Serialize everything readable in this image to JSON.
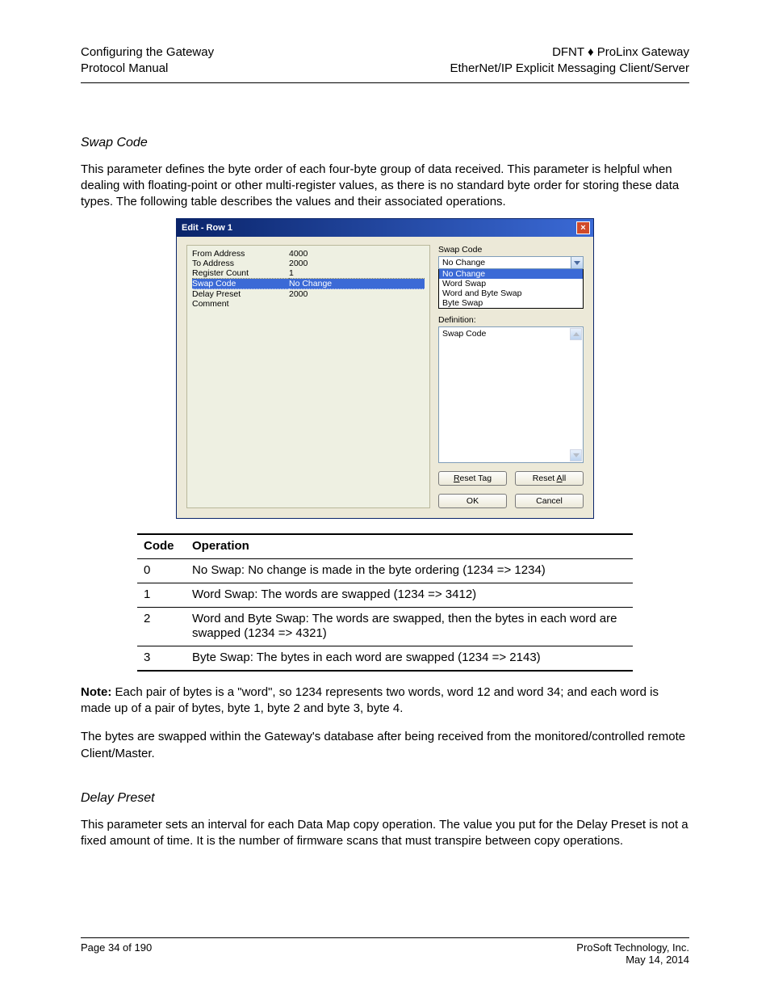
{
  "header": {
    "left_line1": "Configuring the Gateway",
    "left_line2": "Protocol Manual",
    "right_line1": "DFNT ♦ ProLinx Gateway",
    "right_line2": "EtherNet/IP Explicit Messaging Client/Server"
  },
  "section_title": "Swap Code",
  "intro_para": "This parameter defines the byte order of each four-byte group of data received. This parameter is helpful when dealing with floating-point or other multi-register values, as there is no standard byte order for storing these data types. The following table describes the values and their associated operations.",
  "dialog": {
    "title": "Edit - Row 1",
    "rows": [
      {
        "k": "From Address",
        "v": "4000"
      },
      {
        "k": "To Address",
        "v": "2000"
      },
      {
        "k": "Register Count",
        "v": "1",
        "dotted": true
      },
      {
        "k": "Swap Code",
        "v": "No Change",
        "selected": true,
        "dotted": true
      },
      {
        "k": "Delay Preset",
        "v": "2000"
      },
      {
        "k": "Comment",
        "v": ""
      }
    ],
    "right_label": "Swap Code",
    "combo_value": "No Change",
    "options": [
      "No Change",
      "Word Swap",
      "Word and Byte Swap",
      "Byte Swap"
    ],
    "selected_option_index": 0,
    "definition_label": "Definition:",
    "definition_text": "Swap Code",
    "buttons": {
      "reset_tag": "Reset Tag",
      "reset_all": "Reset All",
      "ok": "OK",
      "cancel": "Cancel"
    }
  },
  "options_table": {
    "headers": [
      "Code",
      "Operation"
    ],
    "rows": [
      [
        "0",
        "No Swap: No change is made in the byte ordering (1234 => 1234)"
      ],
      [
        "1",
        "Word Swap: The words are swapped (1234 => 3412)"
      ],
      [
        "2",
        "Word and Byte Swap: The words are swapped, then the bytes in each word are swapped (1234 => 4321)"
      ],
      [
        "3",
        "Byte Swap: The bytes in each word are swapped (1234 => 2143)"
      ]
    ]
  },
  "note_lead": "Note: ",
  "note_text": "Each pair of bytes is a \"word\", so 1234 represents two words, word 12 and word 34; and each word is made up of a pair of bytes, byte 1, byte 2 and byte 3, byte 4.",
  "note_sub": "The bytes are swapped within the Gateway's database after being received from the monitored/controlled remote Client/Master.",
  "delay_section_title": "Delay Preset",
  "delay_para": "This parameter sets an interval for each Data Map copy operation. The value you put for the Delay Preset is not a fixed amount of time. It is the number of firmware scans that must transpire between copy operations.",
  "footer": {
    "left": "Page 34 of 190",
    "right_top": "ProSoft Technology, Inc.",
    "right_bottom": "May 14, 2014"
  }
}
